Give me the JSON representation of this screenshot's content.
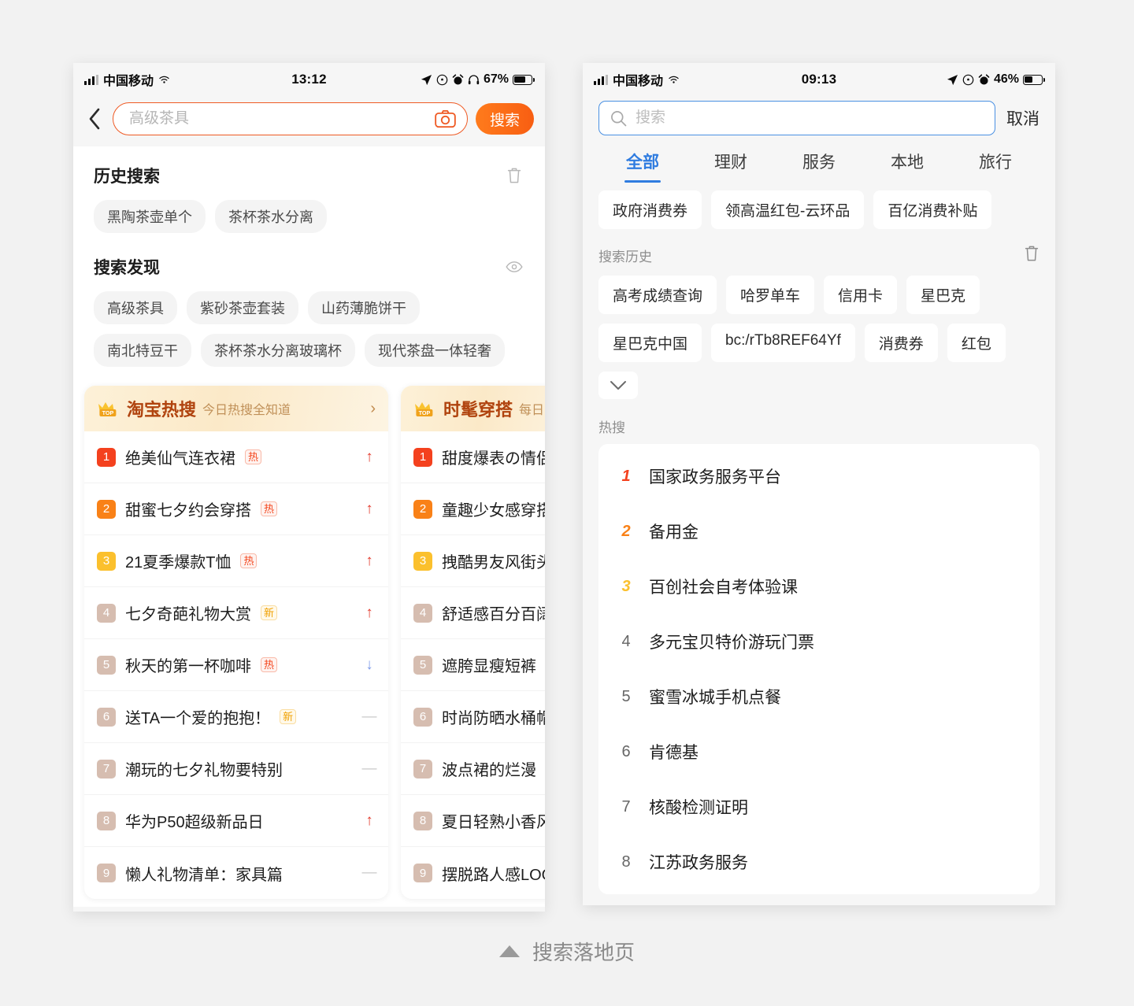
{
  "caption": {
    "text": "搜索落地页",
    "icon": "triangle-up-icon"
  },
  "colors": {
    "accent_orange": "#ef5a24",
    "accent_blue": "#2f7ce0",
    "trend_up": "#e33b2e",
    "trend_down": "#7d9ae8",
    "rank1": "#f4411e",
    "rank2": "#f98117",
    "rank3": "#fbc02d",
    "rank_rest": "#d6bdb0"
  },
  "left_phone": {
    "status": {
      "carrier": "中国移动",
      "time": "13:12",
      "battery_text": "67%",
      "battery_level": 67,
      "icons": [
        "signal-bars-icon",
        "wifi-icon",
        "location-arrow-icon",
        "rotation-lock-icon",
        "alarm-icon",
        "headphones-icon"
      ]
    },
    "search": {
      "back_icon": "chevron-left-icon",
      "placeholder": "高级茶具",
      "value": "",
      "camera_icon": "camera-icon",
      "button_label": "搜索"
    },
    "history": {
      "title": "历史搜索",
      "clear_icon": "trash-icon",
      "items": [
        "黑陶茶壶单个",
        "茶杯茶水分离"
      ]
    },
    "discover": {
      "title": "搜索发现",
      "toggle_icon": "eye-icon",
      "items": [
        "高级茶具",
        "紫砂茶壶套装",
        "山药薄脆饼干",
        "南北特豆干",
        "茶杯茶水分离玻璃杯",
        "现代茶盘一体轻奢"
      ]
    },
    "cards": [
      {
        "badge": "TOP",
        "badge_icon": "crown-icon",
        "title": "淘宝热搜",
        "subtitle": "今日热搜全知道",
        "arrow_icon": "chevron-right-icon",
        "rows": [
          {
            "rank": "1",
            "label": "绝美仙气连衣裙",
            "tag": "热",
            "trend": "up"
          },
          {
            "rank": "2",
            "label": "甜蜜七夕约会穿搭",
            "tag": "热",
            "trend": "up"
          },
          {
            "rank": "3",
            "label": "21夏季爆款T恤",
            "tag": "热",
            "trend": "up"
          },
          {
            "rank": "4",
            "label": "七夕奇葩礼物大赏",
            "tag": "新",
            "trend": "up"
          },
          {
            "rank": "5",
            "label": "秋天的第一杯咖啡",
            "tag": "热",
            "trend": "down"
          },
          {
            "rank": "6",
            "label": "送TA一个爱的抱抱！",
            "tag": "新",
            "trend": "flat"
          },
          {
            "rank": "7",
            "label": "潮玩的七夕礼物要特别",
            "tag": "",
            "trend": "flat"
          },
          {
            "rank": "8",
            "label": "华为P50超级新品日",
            "tag": "",
            "trend": "up"
          },
          {
            "rank": "9",
            "label": "懒人礼物清单：家具篇",
            "tag": "",
            "trend": "flat"
          }
        ]
      },
      {
        "badge": "TOP",
        "badge_icon": "crown-icon",
        "title": "时髦穿搭",
        "subtitle": "每日",
        "arrow_icon": "",
        "rows": [
          {
            "rank": "1",
            "label": "甜度爆表の情侣",
            "tag": "",
            "trend": ""
          },
          {
            "rank": "2",
            "label": "童趣少女感穿搭",
            "tag": "",
            "trend": ""
          },
          {
            "rank": "3",
            "label": "拽酷男友风街头",
            "tag": "",
            "trend": ""
          },
          {
            "rank": "4",
            "label": "舒适感百分百阔",
            "tag": "",
            "trend": ""
          },
          {
            "rank": "5",
            "label": "遮胯显瘦短裤",
            "tag": "",
            "trend": ""
          },
          {
            "rank": "6",
            "label": "时尚防晒水桶帽",
            "tag": "",
            "trend": ""
          },
          {
            "rank": "7",
            "label": "波点裙的烂漫",
            "tag": "",
            "trend": ""
          },
          {
            "rank": "8",
            "label": "夏日轻熟小香风",
            "tag": "",
            "trend": ""
          },
          {
            "rank": "9",
            "label": "摆脱路人感LOO",
            "tag": "",
            "trend": ""
          }
        ]
      }
    ]
  },
  "right_phone": {
    "status": {
      "carrier": "中国移动",
      "time": "09:13",
      "battery_text": "46%",
      "battery_level": 46,
      "icons": [
        "signal-bars-icon",
        "wifi-icon",
        "location-arrow-icon",
        "rotation-lock-icon",
        "alarm-icon"
      ]
    },
    "search": {
      "search_icon": "magnifier-icon",
      "placeholder": "搜索",
      "value": "",
      "cancel_label": "取消"
    },
    "tabs": [
      {
        "label": "全部",
        "active": true
      },
      {
        "label": "理财",
        "active": false
      },
      {
        "label": "服务",
        "active": false
      },
      {
        "label": "本地",
        "active": false
      },
      {
        "label": "旅行",
        "active": false
      }
    ],
    "promo_chips": [
      "政府消费券",
      "领高温红包-云环品",
      "百亿消费补贴"
    ],
    "history": {
      "title": "搜索历史",
      "clear_icon": "trash-icon",
      "items": [
        "高考成绩查询",
        "哈罗单车",
        "信用卡",
        "星巴克",
        "星巴克中国",
        "bc:/rTb8REF64Yf",
        "消费券",
        "红包"
      ],
      "expand_icon": "chevron-down-icon"
    },
    "hot": {
      "title": "热搜",
      "items": [
        {
          "rank": "1",
          "label": "国家政务服务平台"
        },
        {
          "rank": "2",
          "label": "备用金"
        },
        {
          "rank": "3",
          "label": "百创社会自考体验课"
        },
        {
          "rank": "4",
          "label": "多元宝贝特价游玩门票"
        },
        {
          "rank": "5",
          "label": "蜜雪冰城手机点餐"
        },
        {
          "rank": "6",
          "label": "肯德基"
        },
        {
          "rank": "7",
          "label": "核酸检测证明"
        },
        {
          "rank": "8",
          "label": "江苏政务服务"
        }
      ]
    }
  }
}
